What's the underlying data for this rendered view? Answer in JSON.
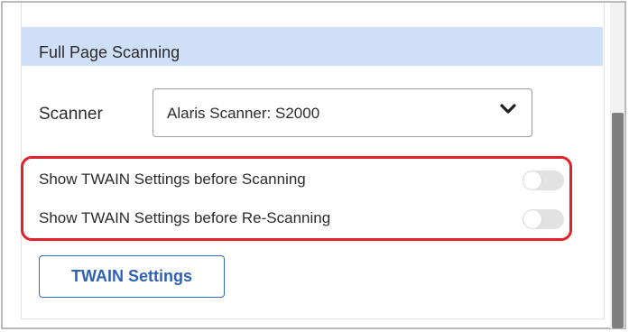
{
  "panel": {
    "title": "Full Page Scanning"
  },
  "scanner": {
    "label": "Scanner",
    "selected_value": "Alaris Scanner: S2000"
  },
  "settings": [
    {
      "label": "Show TWAIN Settings before Scanning",
      "enabled": false
    },
    {
      "label": "Show TWAIN Settings before Re-Scanning",
      "enabled": false
    }
  ],
  "twain_button": {
    "label": "TWAIN Settings"
  },
  "colors": {
    "header_bg": "#cfdff7",
    "highlight_border": "#e0202a",
    "button_accent": "#2e62b4",
    "toggle_off": "#e2e2e2"
  },
  "icons": {
    "dropdown": "chevron-down-icon"
  }
}
